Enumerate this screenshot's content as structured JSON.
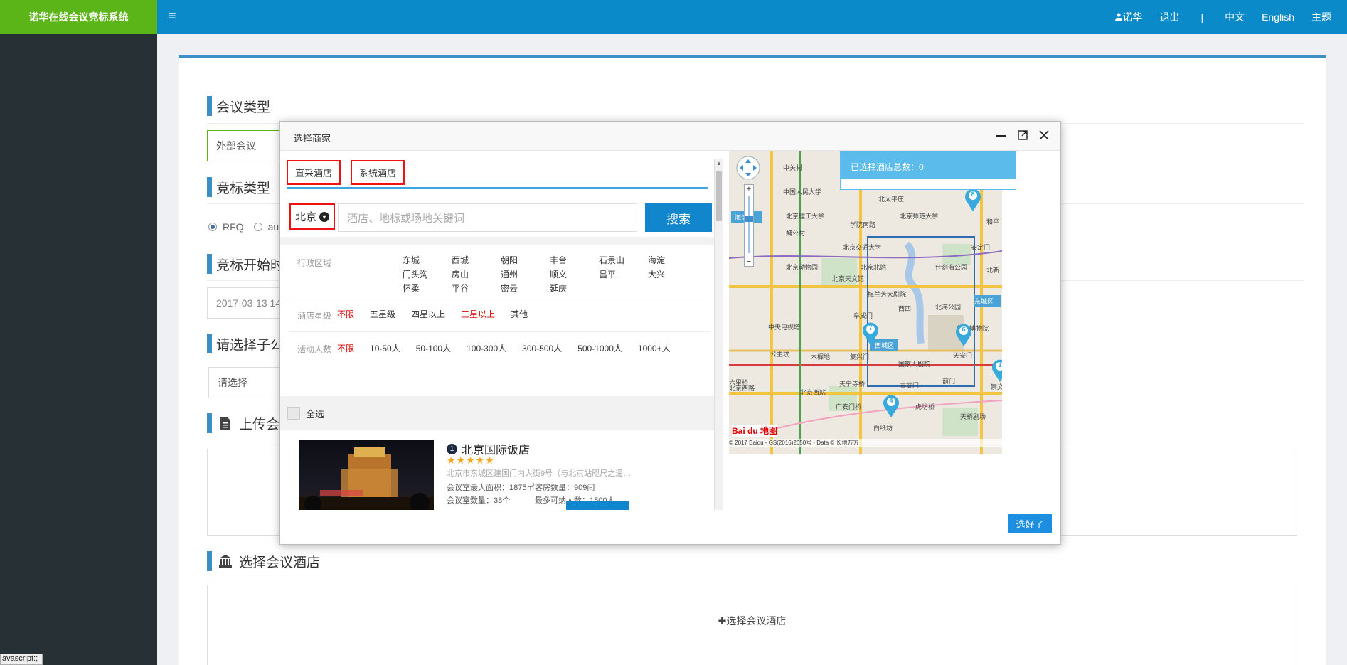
{
  "app": {
    "brand": "诺华在线会议竞标系统"
  },
  "topnav": {
    "user": "诺华",
    "logout": "退出",
    "separator": "|",
    "lang_zh": "中文",
    "lang_en": "English",
    "theme": "主题"
  },
  "status_bar": "avascript:;",
  "form": {
    "meeting_type_title": "会议类型",
    "meeting_type_value": "外部会议",
    "bid_type_title": "竞标类型",
    "bid_type_options": [
      "RFQ",
      "au"
    ],
    "bid_start_title": "竞标开始时",
    "bid_start_value": "2017-03-13 14",
    "sub_company_title": "请选择子公",
    "sub_company_placeholder": "请选择",
    "upload_title": "上传会议",
    "hotel_title": "选择会议酒店",
    "add_hotel": "选择会议酒店"
  },
  "modal": {
    "title": "选择商家",
    "tabs": [
      "直采酒店",
      "系统酒店"
    ],
    "city": "北京",
    "search_placeholder": "酒店、地标或场地关键词",
    "search_button": "搜索",
    "district_label": "行政区域",
    "districts": [
      "东城",
      "西城",
      "朝阳",
      "丰台",
      "石景山",
      "海淀",
      "门头沟",
      "房山",
      "通州",
      "顺义",
      "昌平",
      "大兴",
      "怀柔",
      "平谷",
      "密云",
      "延庆"
    ],
    "star_label": "酒店星级",
    "star_options": [
      "不限",
      "五星级",
      "四星以上",
      "三星以上",
      "其他"
    ],
    "people_label": "活动人数",
    "people_options": [
      "不限",
      "10-50人",
      "50-100人",
      "100-300人",
      "300-500人",
      "500-1000人",
      "1000+人"
    ],
    "select_all": "全选",
    "hotel": {
      "index": "1",
      "name": "北京国际饭店",
      "stars": "★★★★★",
      "address": "北京市东城区建国门内大街9号（与北京站咫尺之遥）| ...",
      "max_area": "会议室最大面积：1875㎡",
      "rooms": "客房数量：909间",
      "meeting_rooms": "会议室数量：38个",
      "max_people": "最多可纳人数：1500人"
    },
    "selected_count": "已选择酒店总数：0",
    "ok_button": "选好了",
    "map": {
      "labels": [
        "中关村",
        "中国人民大学",
        "北太平庄",
        "北京理工大学",
        "北京师范大学",
        "学院南路",
        "魏公村",
        "北京交通大学",
        "安定门",
        "北京动物园",
        "北京北站",
        "什刹海公园",
        "北新",
        "北京天文馆",
        "梅兰芳大剧院",
        "东城区",
        "阜成门",
        "西四",
        "北海公园",
        "中央电视塔",
        "故宫博物院",
        "西城区",
        "公主坟",
        "木樨地",
        "复兴门",
        "天安门",
        "国家大剧院",
        "北京西站",
        "天宁寺桥",
        "宣武门",
        "前门",
        "崇文",
        "六里桥",
        "广安门桥",
        "虎坊桥",
        "白纸坊",
        "天桥剧场",
        "海淀区",
        "和平",
        "北京西路"
      ],
      "pins": [
        "8",
        "7",
        "6",
        "4",
        "1"
      ],
      "copyright": "© 2017 Baidu - GS(2016)2650号 - Data © 长地万方",
      "logo": "Bai du 地图"
    }
  }
}
